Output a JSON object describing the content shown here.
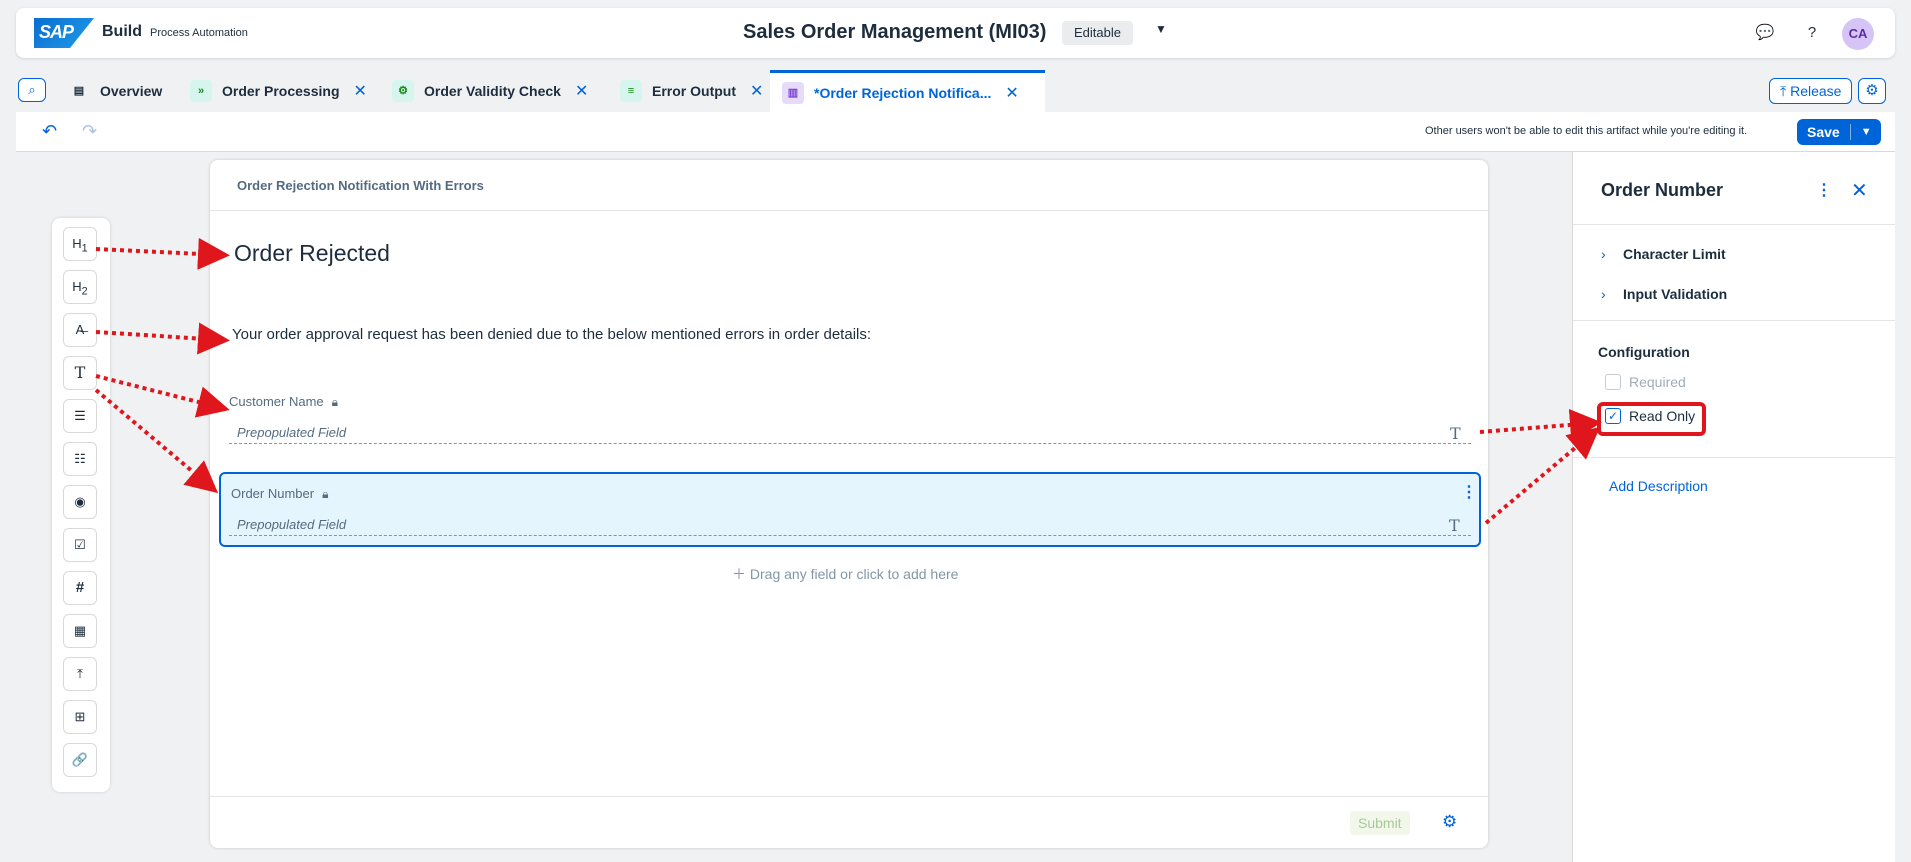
{
  "shell": {
    "logo": "SAP",
    "product": "Build",
    "product_sub": "Process Automation",
    "project_title": "Sales Order Management (MI03)",
    "status": "Editable",
    "avatar_initials": "CA"
  },
  "tabs": [
    {
      "label": "Overview",
      "icon": "overview-icon",
      "closable": false
    },
    {
      "label": "Order Processing",
      "icon": "process-icon",
      "closable": true
    },
    {
      "label": "Order Validity Check",
      "icon": "decision-icon",
      "closable": true
    },
    {
      "label": "Error Output",
      "icon": "data-type-icon",
      "closable": true
    },
    {
      "label": "*Order Rejection Notifica...",
      "icon": "form-icon",
      "closable": true,
      "active": true
    }
  ],
  "actions": {
    "release_label": "Release",
    "save_label": "Save"
  },
  "toolbar": {
    "lock_message": "Other users won't be able to edit this artifact while you're editing it."
  },
  "palette": [
    "H1",
    "H2",
    "paragraph",
    "text-input",
    "text-area",
    "list",
    "radio",
    "checkbox",
    "number",
    "date",
    "upload",
    "table",
    "link"
  ],
  "form": {
    "title": "Order Rejection Notification With Errors",
    "heading": "Order Rejected",
    "paragraph": "Your order approval request has been denied due to the below mentioned errors in order details:",
    "fields": [
      {
        "label": "Customer Name",
        "placeholder": "Prepopulated Field",
        "read_only": true
      },
      {
        "label": "Order Number",
        "placeholder": "Prepopulated Field",
        "read_only": true,
        "selected": true
      }
    ],
    "drag_hint": "Drag any field or click to add here",
    "submit_label": "Submit"
  },
  "panel": {
    "title": "Order Number",
    "sections": [
      "Character Limit",
      "Input Validation"
    ],
    "config_title": "Configuration",
    "required_label": "Required",
    "required_checked": false,
    "read_only_label": "Read Only",
    "read_only_checked": true,
    "add_description": "Add Description"
  },
  "colors": {
    "accent": "#0064d9",
    "annotation": "#e0161d",
    "selected_bg": "#e5f5fd"
  }
}
